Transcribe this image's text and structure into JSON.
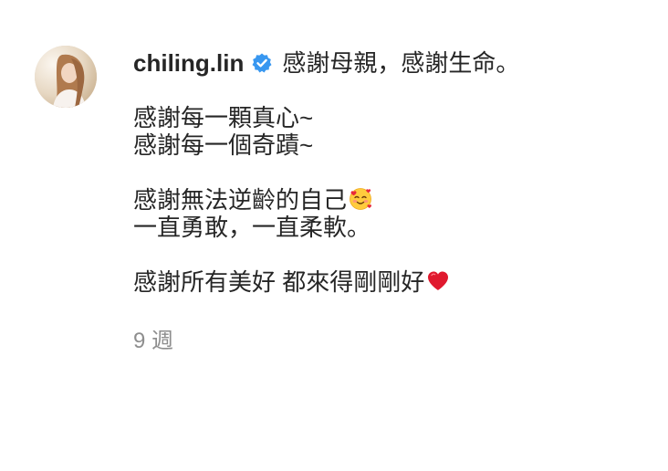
{
  "comment": {
    "username": "chiling.lin",
    "verified_icon": "verified-badge-icon",
    "accent_color": "#3897f0",
    "lines": [
      "感謝母親，感謝生命。",
      "",
      "感謝每一顆真心~",
      "感謝每一個奇蹟~",
      "",
      "感謝無法逆齡的自己",
      "一直勇敢，一直柔軟。",
      "",
      "感謝所有美好 都來得剛剛好"
    ],
    "emojis": {
      "line6": "smiling-face-with-hearts-icon",
      "line9": "red-heart-icon"
    },
    "timestamp": "9 週"
  }
}
